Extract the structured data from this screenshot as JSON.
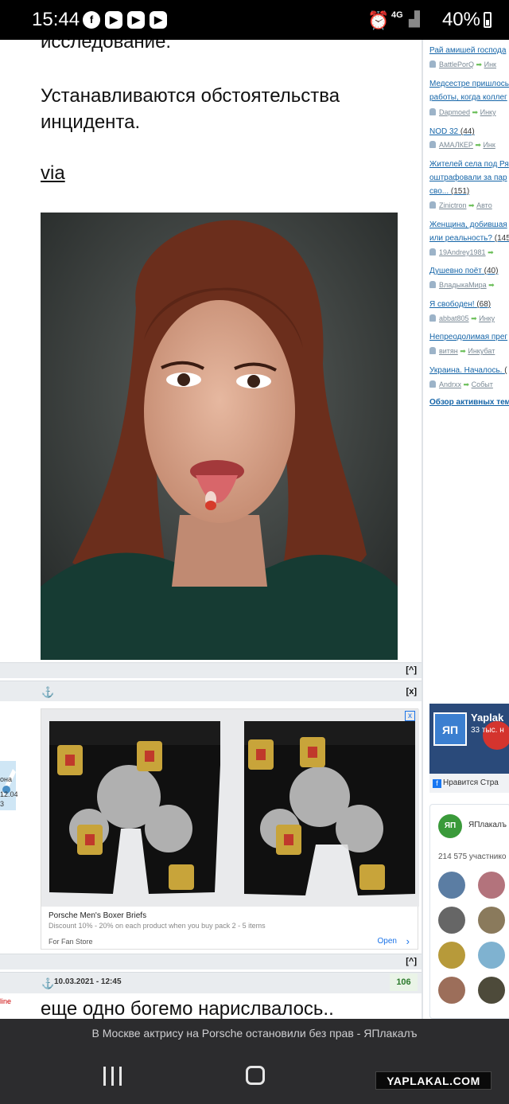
{
  "status_bar": {
    "time": "15:44",
    "app_icons": [
      "facebook-icon",
      "youtube-icon",
      "youtube-icon",
      "youtube-icon"
    ],
    "right_text": "4G",
    "battery": "40%"
  },
  "post": {
    "paragraph_1": "исследование.",
    "paragraph_2": "Устанавливаются обстоятельства инцидента.",
    "via": "via",
    "small_btn": "[^]",
    "close_btn": "[x]",
    "anchor": "⚓"
  },
  "ad": {
    "title": "Porsche Men's Boxer Briefs",
    "subtitle": "Discount 10% - 20% on each product when you buy pack 2 - 5 items",
    "store": "For Fan Store",
    "open": "Open",
    "arrow": "›",
    "close": "x"
  },
  "left_user": {
    "line1": "она",
    "line2": "12.04",
    "line3": "3",
    "online": "line"
  },
  "next_post": {
    "anchor": "⚓",
    "date": "10.03.2021 - 12:45",
    "score": "106",
    "text": "еще одно богемо нарислвалось..",
    "small_btn": "[^]"
  },
  "sidebar": {
    "items": [
      {
        "title": "Рай амишей господа",
        "count": "",
        "meta_user": "BattlePorQ",
        "meta_cat": "Инк"
      },
      {
        "title": "Медсестре пришлось",
        "title2": "работы, когда коллег",
        "count": "",
        "meta_user": "Dapmoed",
        "meta_cat": "Инку"
      },
      {
        "title": "NOD 32",
        "count": "(44)",
        "meta_user": "АМАЛКЕР",
        "meta_cat": "Инк"
      },
      {
        "title": "Жителей села под Ря",
        "title2": "оштрафовали за пар",
        "title3": "сво...",
        "count": "(151)",
        "meta_user": "Zinictron",
        "meta_cat": "Авто"
      },
      {
        "title": "Женщина, добившая",
        "title2": "или реальность?",
        "count": "(145",
        "meta_user": "19Andrey1981",
        "meta_cat": ""
      },
      {
        "title": "Душевно поёт",
        "count": "(40)",
        "meta_user": "ВладыкаМира",
        "meta_cat": ""
      },
      {
        "title": "Я свободен!",
        "count": "(68)",
        "meta_user": "abbat805",
        "meta_cat": "Инку"
      },
      {
        "title": "Непреодолимая прег",
        "count": "",
        "meta_user": "витян",
        "meta_cat": "Инкубат"
      },
      {
        "title": "Украина. Началось.",
        "count": "(",
        "meta_user": "Andrxx",
        "meta_cat": "Событ"
      }
    ],
    "overview": "Обзор активных тем",
    "fb_name": "Yaplak",
    "fb_sub": "33 тыс. н",
    "fb_like": "Нравится Стра",
    "vk_logo": "ЯП",
    "vk_name": "ЯПлакалъ",
    "vk_members": "214 575 участнико"
  },
  "notification": "В Москве актрису на Porsche остановили без прав - ЯПлакалъ",
  "watermark": "YAPLAKAL.COM"
}
